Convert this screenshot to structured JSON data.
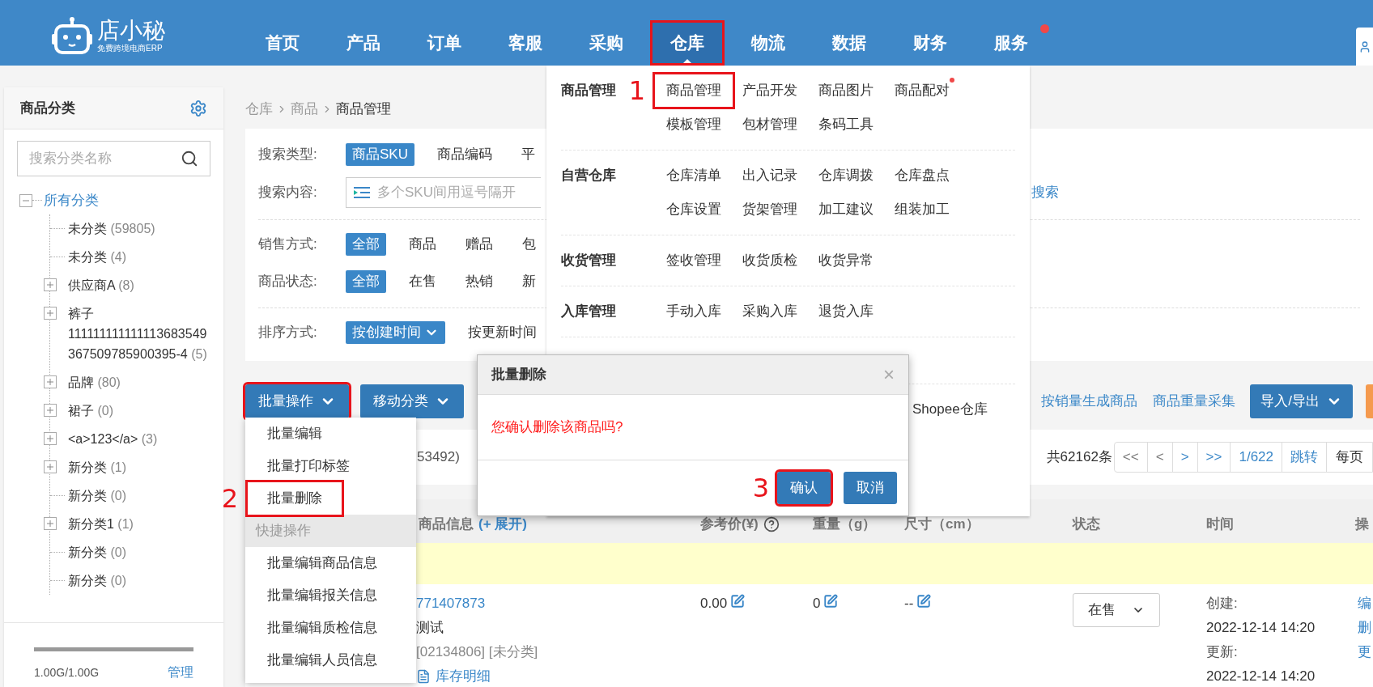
{
  "header": {
    "logo_name": "店小秘",
    "logo_tagline": "免费跨境电商ERP",
    "nav": [
      {
        "label": "首页",
        "selected": false,
        "highlighted": false,
        "badge": false
      },
      {
        "label": "产品",
        "selected": false,
        "highlighted": false,
        "badge": false
      },
      {
        "label": "订单",
        "selected": false,
        "highlighted": false,
        "badge": false
      },
      {
        "label": "客服",
        "selected": false,
        "highlighted": false,
        "badge": false
      },
      {
        "label": "采购",
        "selected": false,
        "highlighted": false,
        "badge": false
      },
      {
        "label": "仓库",
        "selected": true,
        "highlighted": true,
        "badge": false
      },
      {
        "label": "物流",
        "selected": false,
        "highlighted": false,
        "badge": false
      },
      {
        "label": "数据",
        "selected": false,
        "highlighted": false,
        "badge": false
      },
      {
        "label": "财务",
        "selected": false,
        "highlighted": false,
        "badge": false
      },
      {
        "label": "服务",
        "selected": false,
        "highlighted": false,
        "badge": true
      }
    ]
  },
  "sidebar": {
    "title": "商品分类",
    "search": {
      "placeholder": "搜索分类名称"
    },
    "tree": {
      "label": "所有分类",
      "kind": "expanded",
      "children": [
        {
          "label": "未分类",
          "count": "(59805)",
          "kind": "leaf"
        },
        {
          "label": "未分类",
          "count": "(4)",
          "kind": "leaf"
        },
        {
          "label": "供应商A",
          "count": "(8)",
          "kind": "collapsed"
        },
        {
          "label": "裤子 111111111111113683549367509785900395-4",
          "count": "(5)",
          "kind": "collapsed"
        },
        {
          "label": "品牌",
          "count": "(80)",
          "kind": "collapsed"
        },
        {
          "label": "裙子",
          "count": "(0)",
          "kind": "collapsed"
        },
        {
          "label": "<a>123</a>",
          "count": "(3)",
          "kind": "collapsed"
        },
        {
          "label": "新分类",
          "count": "(1)",
          "kind": "collapsed"
        },
        {
          "label": "新分类",
          "count": "(0)",
          "kind": "leaf"
        },
        {
          "label": "新分类1",
          "count": "(1)",
          "kind": "collapsed"
        },
        {
          "label": "新分类",
          "count": "(0)",
          "kind": "leaf"
        },
        {
          "label": "新分类",
          "count": "(0)",
          "kind": "leaf"
        }
      ]
    },
    "storage": {
      "level": 1,
      "text": "1.00G/1.00G",
      "action": "管理"
    }
  },
  "breadcrumb": [
    "仓库",
    "商品",
    "商品管理"
  ],
  "filters": [
    {
      "kind": "chips",
      "label": "搜索类型:",
      "divider_after": false,
      "options": [
        {
          "label": "商品SKU",
          "selected": true
        },
        {
          "label": "商品编码",
          "selected": false
        },
        {
          "label": "平",
          "selected": false
        }
      ]
    },
    {
      "kind": "input",
      "label": "搜索内容:",
      "divider_after": true,
      "placeholder": "多个SKU间用逗号隔开",
      "link": "搜索"
    },
    {
      "kind": "chips",
      "label": "销售方式:",
      "divider_after": false,
      "options": [
        {
          "label": "全部",
          "selected": true
        },
        {
          "label": "商品",
          "selected": false
        },
        {
          "label": "赠品",
          "selected": false
        },
        {
          "label": "包",
          "selected": false
        }
      ]
    },
    {
      "kind": "chips",
      "label": "商品状态:",
      "divider_after": true,
      "options": [
        {
          "label": "全部",
          "selected": true
        },
        {
          "label": "在售",
          "selected": false
        },
        {
          "label": "热销",
          "selected": false
        },
        {
          "label": "新",
          "selected": false
        }
      ]
    },
    {
      "kind": "sort",
      "label": "排序方式:",
      "divider_after": false,
      "options": [
        {
          "label": "按创建时间",
          "selected": true
        },
        {
          "label": "按更新时间",
          "selected": false
        }
      ]
    }
  ],
  "toolbar": {
    "buttons": [
      {
        "label": "批量操作",
        "highlighted": true
      },
      {
        "label": "移动分类",
        "highlighted": false
      }
    ],
    "links": [
      "按销量生成商品",
      "商品重量采集"
    ],
    "right_button": "导入/导出"
  },
  "stats": {
    "count_fragment": "53492)",
    "total": "共62162条",
    "pager": [
      {
        "label": "<<",
        "disabled": true
      },
      {
        "label": "<",
        "disabled": true
      },
      {
        "label": ">",
        "disabled": false
      },
      {
        "label": ">>",
        "disabled": false
      },
      {
        "label": "1/622",
        "disabled": false
      },
      {
        "label": "跳转",
        "disabled": false
      }
    ],
    "per_page": "每页"
  },
  "table": {
    "columns": [
      {
        "label": "商品信息",
        "extra": "(+ 展开)",
        "help": false
      },
      {
        "label": "参考价(¥)",
        "help": true
      },
      {
        "label": "重量（g）",
        "help": false
      },
      {
        "label": "尺寸（cm）",
        "help": false
      },
      {
        "label": "状态",
        "help": false
      },
      {
        "label": "时间",
        "help": false
      },
      {
        "label": "操",
        "help": false
      }
    ],
    "rows": [
      {
        "sku": "771407873",
        "name": "测试",
        "meta": "[02134806] [未分类]",
        "stock_link": "库存明细",
        "price": "0.00",
        "weight": "0",
        "size": "--",
        "status": "在售",
        "created_label": "创建:",
        "created": "2022-12-14 14:20",
        "updated_label": "更新:",
        "updated": "2022-12-14 14:20",
        "actions": [
          "编",
          "删",
          "更"
        ]
      }
    ]
  },
  "warehouse_menu": {
    "sections": [
      {
        "label": "商品管理",
        "items": [
          {
            "label": "商品管理",
            "highlighted": true,
            "step": "1",
            "badge": false
          },
          {
            "label": "产品开发",
            "highlighted": false,
            "badge": false
          },
          {
            "label": "商品图片",
            "highlighted": false,
            "badge": false
          },
          {
            "label": "商品配对",
            "highlighted": false,
            "badge": true
          },
          {
            "label": "模板管理",
            "highlighted": false,
            "badge": false
          },
          {
            "label": "包材管理",
            "highlighted": false,
            "badge": false
          },
          {
            "label": "条码工具",
            "highlighted": false,
            "badge": false
          }
        ]
      },
      {
        "label": "自营仓库",
        "items": [
          {
            "label": "仓库清单",
            "highlighted": false,
            "badge": false
          },
          {
            "label": "出入记录",
            "highlighted": false,
            "badge": false
          },
          {
            "label": "仓库调拨",
            "highlighted": false,
            "badge": false
          },
          {
            "label": "仓库盘点",
            "highlighted": false,
            "badge": false
          },
          {
            "label": "仓库设置",
            "highlighted": false,
            "badge": false
          },
          {
            "label": "货架管理",
            "highlighted": false,
            "badge": false
          },
          {
            "label": "加工建议",
            "highlighted": false,
            "badge": false
          },
          {
            "label": "组装加工",
            "highlighted": false,
            "badge": false
          }
        ]
      },
      {
        "label": "收货管理",
        "items": [
          {
            "label": "签收管理",
            "highlighted": false,
            "badge": false
          },
          {
            "label": "收货质检",
            "highlighted": false,
            "badge": false
          },
          {
            "label": "收货异常",
            "highlighted": false,
            "badge": false
          }
        ]
      },
      {
        "label": "入库管理",
        "items": [
          {
            "label": "手动入库",
            "highlighted": false,
            "badge": false
          },
          {
            "label": "采购入库",
            "highlighted": false,
            "badge": false
          },
          {
            "label": "退货入库",
            "highlighted": false,
            "badge": false
          }
        ]
      },
      {
        "items": [
          {
            "label": "Shopee仓库",
            "highlighted": false,
            "badge": false
          }
        ]
      }
    ]
  },
  "batch_menu": {
    "items": [
      {
        "kind": "item",
        "label": "批量编辑",
        "highlighted": false
      },
      {
        "kind": "item",
        "label": "批量打印标签",
        "highlighted": false
      },
      {
        "kind": "item",
        "label": "批量删除",
        "highlighted": true,
        "step": "2"
      },
      {
        "kind": "header",
        "label": "快捷操作",
        "highlighted": false
      },
      {
        "kind": "item",
        "label": "批量编辑商品信息",
        "highlighted": false
      },
      {
        "kind": "item",
        "label": "批量编辑报关信息",
        "highlighted": false
      },
      {
        "kind": "item",
        "label": "批量编辑质检信息",
        "highlighted": false
      },
      {
        "kind": "item",
        "label": "批量编辑人员信息",
        "highlighted": false
      }
    ]
  },
  "dialog": {
    "title": "批量删除",
    "close": "×",
    "message": "您确认删除该商品吗?",
    "buttons": [
      {
        "label": "确认",
        "highlighted": true,
        "step": "3"
      },
      {
        "label": "取消",
        "highlighted": false
      }
    ]
  }
}
